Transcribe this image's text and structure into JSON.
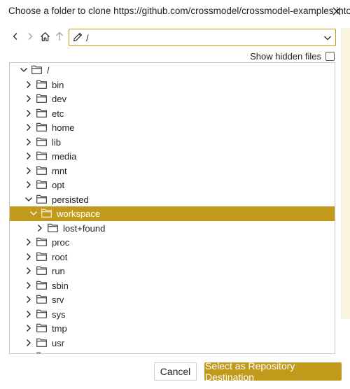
{
  "dialog": {
    "title": "Choose a folder to clone https://github.com/crossmodel/crossmodel-examples into"
  },
  "navbar": {
    "path_value": "/",
    "icons": [
      "chevron-left-icon",
      "chevron-right-icon",
      "home-icon",
      "arrow-up-icon",
      "pencil-icon",
      "chevron-down-icon"
    ]
  },
  "options": {
    "show_hidden_label": "Show hidden files",
    "show_hidden_checked": false
  },
  "tree": {
    "items": [
      {
        "label": "/",
        "depth": 0,
        "expanded": true,
        "selected": false
      },
      {
        "label": "bin",
        "depth": 1,
        "expanded": false,
        "selected": false
      },
      {
        "label": "dev",
        "depth": 1,
        "expanded": false,
        "selected": false
      },
      {
        "label": "etc",
        "depth": 1,
        "expanded": false,
        "selected": false
      },
      {
        "label": "home",
        "depth": 1,
        "expanded": false,
        "selected": false
      },
      {
        "label": "lib",
        "depth": 1,
        "expanded": false,
        "selected": false
      },
      {
        "label": "media",
        "depth": 1,
        "expanded": false,
        "selected": false
      },
      {
        "label": "mnt",
        "depth": 1,
        "expanded": false,
        "selected": false
      },
      {
        "label": "opt",
        "depth": 1,
        "expanded": false,
        "selected": false
      },
      {
        "label": "persisted",
        "depth": 1,
        "expanded": true,
        "selected": false
      },
      {
        "label": "workspace",
        "depth": 2,
        "expanded": true,
        "selected": true
      },
      {
        "label": "lost+found",
        "depth": 3,
        "expanded": false,
        "selected": false
      },
      {
        "label": "proc",
        "depth": 1,
        "expanded": false,
        "selected": false
      },
      {
        "label": "root",
        "depth": 1,
        "expanded": false,
        "selected": false
      },
      {
        "label": "run",
        "depth": 1,
        "expanded": false,
        "selected": false
      },
      {
        "label": "sbin",
        "depth": 1,
        "expanded": false,
        "selected": false
      },
      {
        "label": "srv",
        "depth": 1,
        "expanded": false,
        "selected": false
      },
      {
        "label": "sys",
        "depth": 1,
        "expanded": false,
        "selected": false
      },
      {
        "label": "tmp",
        "depth": 1,
        "expanded": false,
        "selected": false
      },
      {
        "label": "usr",
        "depth": 1,
        "expanded": false,
        "selected": false
      },
      {
        "label": "var",
        "depth": 1,
        "expanded": false,
        "selected": false
      }
    ]
  },
  "footer": {
    "cancel_label": "Cancel",
    "confirm_label": "Select as Repository Destination"
  },
  "colors": {
    "accent": "#c19a1c",
    "selected_text": "#ffffff",
    "border": "#c7c7c7"
  }
}
